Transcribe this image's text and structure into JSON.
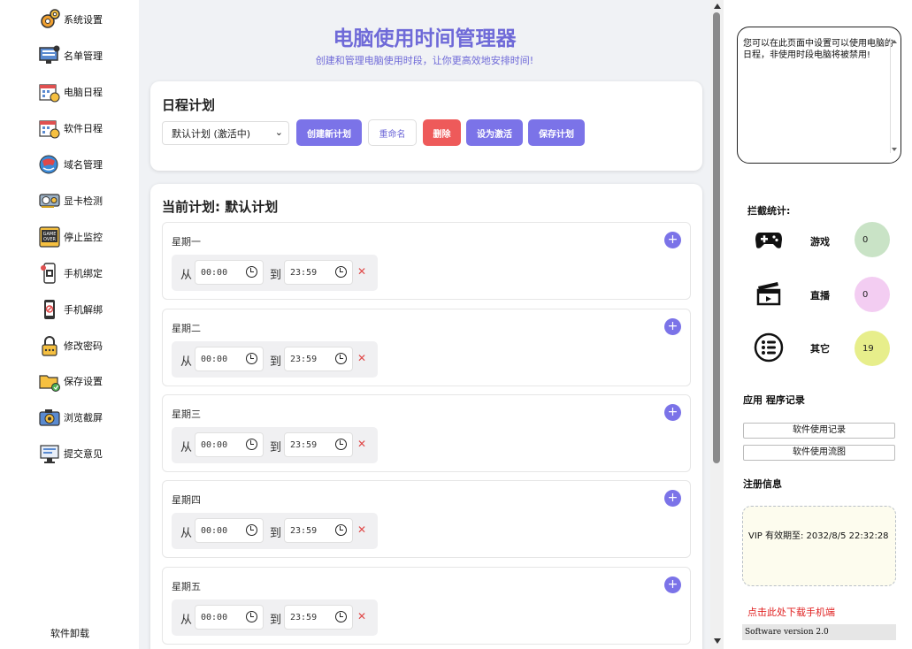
{
  "sidebar": {
    "items": [
      {
        "label": "系统设置",
        "icon": "gear-icon"
      },
      {
        "label": "名单管理",
        "icon": "monitor-list-icon"
      },
      {
        "label": "电脑日程",
        "icon": "calendar-clock-icon"
      },
      {
        "label": "软件日程",
        "icon": "calendar-clock-icon"
      },
      {
        "label": "域名管理",
        "icon": "globe-icon"
      },
      {
        "label": "显卡检测",
        "icon": "graphics-card-icon"
      },
      {
        "label": "停止监控",
        "icon": "game-over-icon"
      },
      {
        "label": "手机绑定",
        "icon": "phone-qr-icon"
      },
      {
        "label": "手机解绑",
        "icon": "phone-unbind-icon"
      },
      {
        "label": "修改密码",
        "icon": "padlock-icon"
      },
      {
        "label": "保存设置",
        "icon": "folder-save-icon"
      },
      {
        "label": "浏览截屏",
        "icon": "camera-icon"
      },
      {
        "label": "提交意见",
        "icon": "feedback-monitor-icon"
      }
    ],
    "uninstall": "软件卸载"
  },
  "header": {
    "title": "电脑使用时间管理器",
    "subtitle": "创建和管理电脑使用时段，让你更高效地安排时间!"
  },
  "schedule": {
    "heading": "日程计划",
    "selected_plan": "默认计划 (激活中)",
    "buttons": {
      "create": "创建新计划",
      "rename": "重命名",
      "delete": "删除",
      "activate": "设为激活",
      "save": "保存计划"
    }
  },
  "current_plan": {
    "heading": "当前计划: 默认计划",
    "from_label": "从",
    "to_label": "到",
    "days": [
      {
        "name": "星期一",
        "start": "00:00",
        "end": "23:59"
      },
      {
        "name": "星期二",
        "start": "00:00",
        "end": "23:59"
      },
      {
        "name": "星期三",
        "start": "00:00",
        "end": "23:59"
      },
      {
        "name": "星期四",
        "start": "00:00",
        "end": "23:59"
      },
      {
        "name": "星期五",
        "start": "00:00",
        "end": "23:59"
      }
    ]
  },
  "right_panel": {
    "notice": "您可以在此页面中设置可以使用电脑的日程，非使用时段电脑将被禁用!",
    "stats_heading": "拦截统计:",
    "stats": [
      {
        "label": "游戏",
        "value": "0",
        "color": "#c9e3c6",
        "icon": "gamepad-icon"
      },
      {
        "label": "直播",
        "value": "0",
        "color": "#f3cdf2",
        "icon": "clapperboard-icon"
      },
      {
        "label": "其它",
        "value": "19",
        "color": "#e7ee8b",
        "icon": "list-circle-icon"
      }
    ],
    "records_heading": "应用 程序记录",
    "records_buttons": [
      "软件使用记录",
      "软件使用流图"
    ],
    "register_heading": "注册信息",
    "vip_text": "VIP 有效期至: 2032/8/5 22:32:28",
    "download_link": "点击此处下载手机端",
    "version": "Software version 2.0"
  },
  "colors": {
    "accent": "#7b73e8",
    "danger": "#ee5a5a"
  }
}
